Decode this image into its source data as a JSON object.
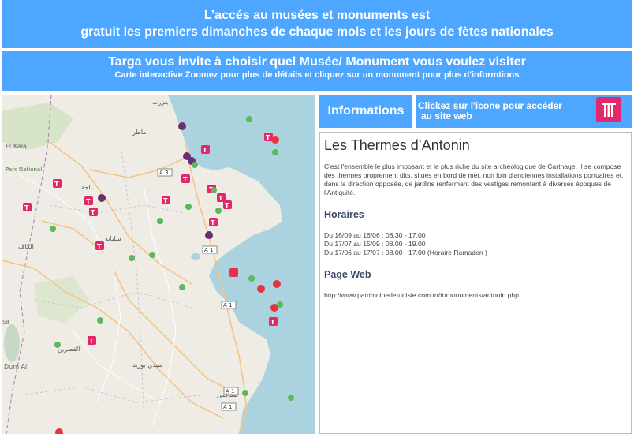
{
  "banner_top": {
    "line1": "L’accés au musées et monuments est",
    "line2": "gratuit  les premiers dimanches de chaque mois et les jours de fètes nationales"
  },
  "banner_second": {
    "title": "Targa vous invite à choisir quel Musée/ Monument vous voulez visiter",
    "subtitle": "Carte interactive Zoomez pour plus de détails et cliquez sur un monument pour plus d'informtions"
  },
  "map": {
    "labels": {
      "parc": "Parc National",
      "kala": "El Kala",
      "kesra": "Dum Ali",
      "a1_1": "A 1",
      "a1_2": "A 1",
      "a1_3": "A 1",
      "a1_4": "A 1",
      "a3": "A 3",
      "sa": "sa",
      "n1": "بنزرت",
      "n2": "ماطر",
      "n3": "باجة",
      "n4": "الكاف",
      "n5": "سليانة",
      "n6": "القصرين",
      "n7": "سيدي بوزيد",
      "n8": "صفاقس"
    },
    "colors": {
      "museum": "#e2276b",
      "monument_green": "#5cb85c",
      "monument_red": "#e8323e",
      "monument_purple": "#6a2f6e"
    }
  },
  "info_button": {
    "label": "Informations"
  },
  "site_button": {
    "line1": "Clickez sur l'icone pour accéder",
    "line2": "au site web",
    "icon": "column-icon"
  },
  "panel": {
    "title": "Les Thermes d’Antonin",
    "description": "C'est l'ensemble le plus imposant et le plus riche du site archéologique de Carthage. Il se compose des thermes proprement dits, situés en bord de mer, non loin d'anciennes installations portuaires et, dans la direction opposée, de jardins renfermant des vestiges remontant à diverses époques de l'Antiquité.",
    "hours_heading": "Horaires",
    "hours": [
      "Du 16/09 au 16/06 : 08.30 - 17.00",
      "Du 17/07 au 15/09 : 08.00 - 19.00",
      "Du 17/06 au 17/07 : 08.00 - 17.00 (Horaire Ramaden )"
    ],
    "web_heading": "Page Web",
    "url": "http://www.patrimoinedetunisie.com.tn/fr/monuments/antonin.php"
  }
}
